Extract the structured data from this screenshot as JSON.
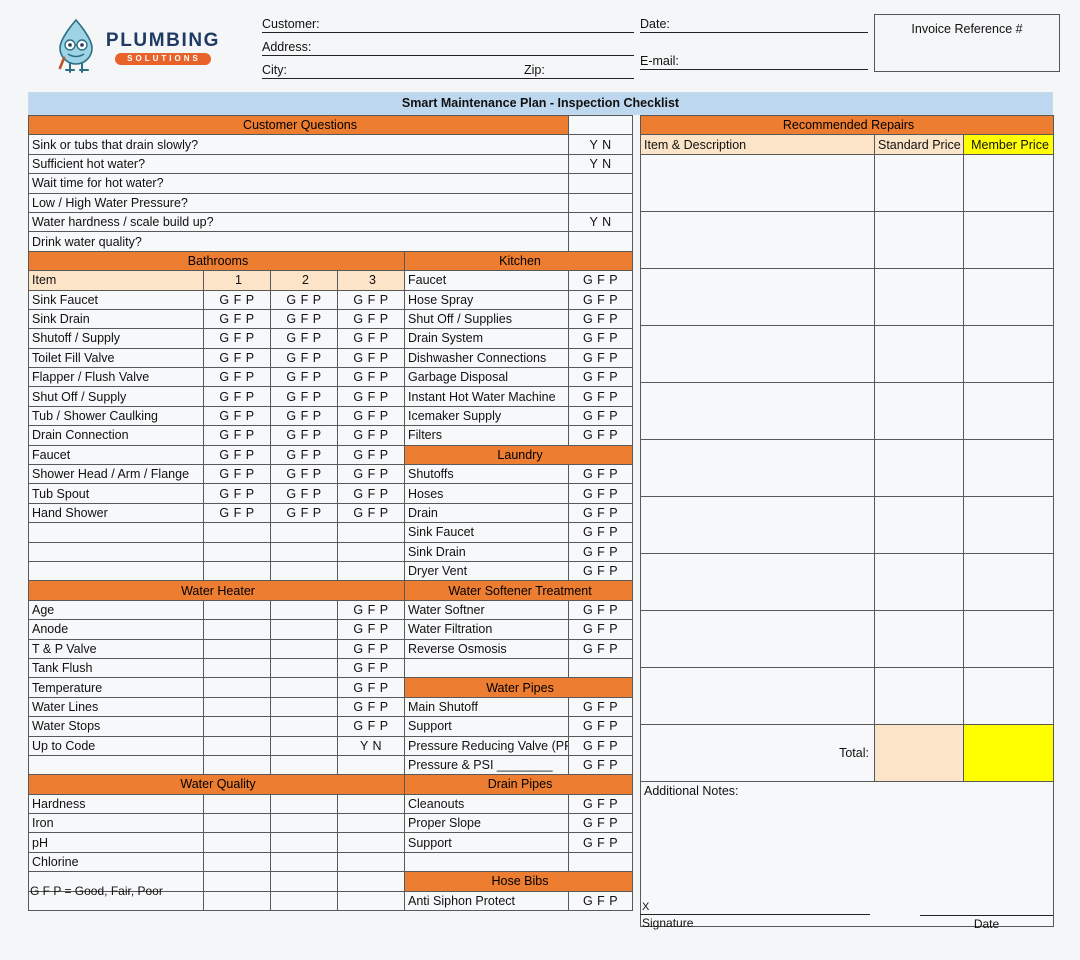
{
  "brand": {
    "name": "PLUMBING",
    "tagline": "SOLUTIONS",
    "logo_icon": "water-droplet-character-icon",
    "orange": "#ed7d31",
    "navy": "#1f3b63"
  },
  "header": {
    "customer_label": "Customer:",
    "customer_value": "",
    "address_label": "Address:",
    "address_value": "",
    "city_label": "City:",
    "city_value": "",
    "zip_label": "Zip:",
    "zip_value": "",
    "date_label": "Date:",
    "date_value": "",
    "email_label": "E-mail:",
    "email_value": "",
    "invoice_ref_label": "Invoice Reference #",
    "invoice_ref_value": ""
  },
  "title": "Smart Maintenance Plan - Inspection Checklist",
  "customer_questions": {
    "heading": "Customer Questions",
    "rows": [
      {
        "label": "Sink or tubs that drain slowly?",
        "mark": "Y   N"
      },
      {
        "label": "Sufficient hot water?",
        "mark": "Y   N"
      },
      {
        "label": "Wait time for hot water?",
        "mark": ""
      },
      {
        "label": "Low / High Water Pressure?",
        "mark": ""
      },
      {
        "label": "Water hardness / scale build up?",
        "mark": "Y   N"
      },
      {
        "label": "Drink water quality?",
        "mark": ""
      }
    ]
  },
  "bathrooms": {
    "heading": "Bathrooms",
    "item_header": "Item",
    "col_headers": [
      "1",
      "2",
      "3"
    ],
    "rating": "G   F   P",
    "rows": [
      "Sink Faucet",
      "Sink Drain",
      "Shutoff / Supply",
      "Toilet Fill Valve",
      "Flapper / Flush Valve",
      "Shut Off / Supply",
      "Tub / Shower Caulking",
      "Drain Connection",
      "Faucet",
      "Shower Head / Arm / Flange",
      "Tub Spout",
      "Hand Shower"
    ],
    "blank_rows": 3
  },
  "kitchen": {
    "heading": "Kitchen",
    "rating": "G   F   P",
    "rows": [
      "Faucet",
      "Hose Spray",
      "Shut Off / Supplies",
      "Drain System",
      "Dishwasher Connections",
      "Garbage Disposal",
      "Instant Hot Water Machine",
      "Icemaker Supply",
      "Filters"
    ]
  },
  "laundry": {
    "heading": "Laundry",
    "rating": "G   F   P",
    "rows": [
      "Shutoffs",
      "Hoses",
      "Drain",
      "Sink Faucet",
      "Sink Drain",
      "Dryer Vent"
    ]
  },
  "water_heater": {
    "heading": "Water Heater",
    "rows": [
      {
        "label": "Age",
        "mark": "G   F   P"
      },
      {
        "label": "Anode",
        "mark": "G   F   P"
      },
      {
        "label": "T & P Valve",
        "mark": "G   F   P"
      },
      {
        "label": "Tank Flush",
        "mark": "G   F   P"
      },
      {
        "label": "Temperature",
        "mark": "G   F   P"
      },
      {
        "label": "Water Lines",
        "mark": "G   F   P"
      },
      {
        "label": "Water Stops",
        "mark": "G   F   P"
      },
      {
        "label": "Up to Code",
        "mark": "Y   N"
      },
      {
        "label": "",
        "mark": ""
      }
    ]
  },
  "water_softener": {
    "heading": "Water Softener Treatment",
    "rating": "G   F   P",
    "rows": [
      "Water Softner",
      "Water Filtration",
      "Reverse Osmosis",
      ""
    ]
  },
  "water_pipes": {
    "heading": "Water Pipes",
    "rating": "G   F   P",
    "rows": [
      "Main Shutoff",
      "Support",
      "Pressure Reducing Valve (PRV)",
      "Pressure & PSI ________"
    ]
  },
  "water_quality": {
    "heading": "Water Quality",
    "rows": [
      "Hardness",
      "Iron",
      "pH",
      "Chlorine",
      "",
      ""
    ]
  },
  "drain_pipes": {
    "heading": "Drain Pipes",
    "rating": "G   F   P",
    "rows": [
      "Cleanouts",
      "Proper Slope",
      "Support",
      ""
    ]
  },
  "hose_bibs": {
    "heading": "Hose Bibs",
    "rating": "G   F   P",
    "rows": [
      "Anti Siphon Protect"
    ]
  },
  "recommended_repairs": {
    "heading": "Recommended Repairs",
    "col_item": "Item & Description",
    "col_standard": "Standard Price",
    "col_member": "Member Price",
    "empty_rows": 10,
    "total_label": "Total:",
    "total_standard": "",
    "total_member": "",
    "notes_label": "Additional Notes:",
    "notes_value": "",
    "member_price_color": "#ffff00",
    "cream_color": "#fce4c8"
  },
  "footer": {
    "legend": "G F P = Good, Fair, Poor",
    "signature_x": "X",
    "signature_caption": "Signature",
    "signature_value": "",
    "date_caption": "Date",
    "date_value": ""
  }
}
